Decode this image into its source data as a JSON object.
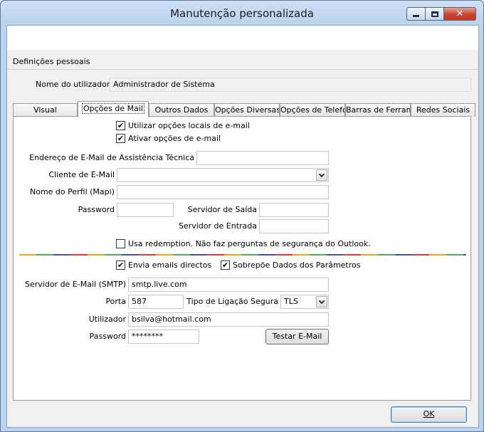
{
  "window": {
    "title": "Manutenção personalizada"
  },
  "section": {
    "title": "Definições pessoais"
  },
  "user": {
    "label": "Nome do utilizador",
    "value": "Administrador de Sistema"
  },
  "tabs": [
    {
      "label": "Visual"
    },
    {
      "label": "Opções de Mail"
    },
    {
      "label": "Outros Dados"
    },
    {
      "label": "Opções Diversas"
    },
    {
      "label": "Opções de Telefo"
    },
    {
      "label": "Barras de Ferram"
    },
    {
      "label": "Redes Sociais"
    }
  ],
  "mail": {
    "use_local_label": "Utilizar opções locais de e-mail",
    "use_local_checked": true,
    "activate_label": "Ativar opções de e-mail",
    "activate_checked": true,
    "support_email_label": "Endereço de E-Mail de Assistência Técnica",
    "support_email_value": "",
    "client_label": "Cliente de E-Mail",
    "client_value": "",
    "profile_label": "Nome do Perfil (Mapi)",
    "profile_value": "",
    "password_label": "Password",
    "password_value": "",
    "out_server_label": "Servidor de Saída",
    "out_server_value": "",
    "in_server_label": "Servidor de Entrada",
    "in_server_value": "",
    "redemption_label": "Usa redemption. Não faz perguntas de segurança do Outlook.",
    "redemption_checked": false
  },
  "smtp": {
    "direct_label": "Envia emails directos",
    "direct_checked": true,
    "override_label": "Sobrepõe Dados dos Parâmetros",
    "override_checked": true,
    "server_label": "Servidor de E-Mail (SMTP)",
    "server_value": "smtp.live.com",
    "port_label": "Porta",
    "port_value": "587",
    "secure_label": "Tipo de Ligação Segura",
    "secure_value": "TLS",
    "user_label": "Utilizador",
    "user_value": "bsilva@hotmail.com",
    "password_label": "Password",
    "password_value": "********",
    "test_label": "Testar E-Mail"
  },
  "footer": {
    "ok_label": "OK"
  },
  "colors": {
    "title_bar": "#bcd3ee",
    "close_button": "#c9462c",
    "rainbow": [
      "#f2a900",
      "#4caf50",
      "#3f51b5",
      "#e53935"
    ]
  }
}
